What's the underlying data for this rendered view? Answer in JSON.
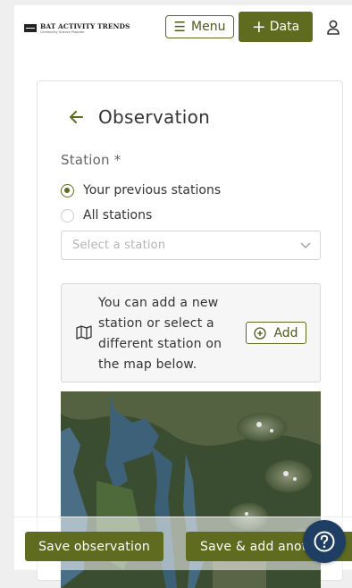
{
  "header": {
    "logo_title": "BAT ACTIVITY TRENDS",
    "logo_subtitle": "Community Science Program",
    "menu_label": "Menu",
    "data_label": "Data"
  },
  "form": {
    "title": "Observation",
    "station_label": "Station *",
    "radio_options": [
      {
        "label": "Your previous stations",
        "checked": true
      },
      {
        "label": "All stations",
        "checked": false
      }
    ],
    "select_placeholder": "Select a station",
    "info_text": "You can add a new station or select a different station on the map below.",
    "add_label": "Add"
  },
  "footer": {
    "save_label": "Save observation",
    "save_add_label": "Save & add another"
  },
  "colors": {
    "accent": "#5f6b1f",
    "help_button": "#1e3f63"
  },
  "icons": {
    "menu": "hamburger-icon",
    "data": "plus-icon",
    "user": "user-icon",
    "back": "arrow-left-icon",
    "select": "chevron-down-icon",
    "map": "map-icon",
    "add": "plus-circle-icon",
    "help": "question-icon"
  }
}
